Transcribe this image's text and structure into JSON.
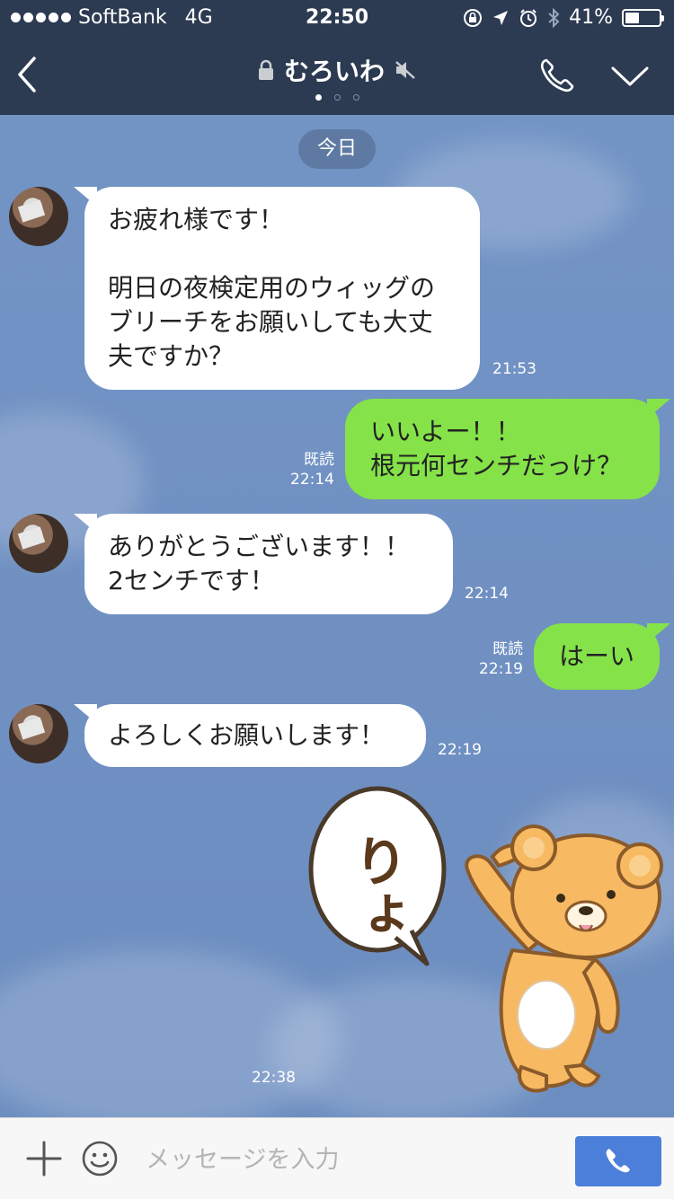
{
  "status": {
    "carrier": "SoftBank",
    "network": "4G",
    "time": "22:50",
    "battery": "41%",
    "battery_level": 0.41
  },
  "nav": {
    "title": "むろいわ",
    "page_count": 3,
    "active_page": 1
  },
  "chat": {
    "date_label": "今日",
    "messages": [
      {
        "side": "in",
        "lines": [
          "お疲れ様です！",
          "",
          "明日の夜検定用のウィッグの",
          "ブリーチをお願いしても大丈",
          "夫ですか？"
        ],
        "time": "21:53"
      },
      {
        "side": "out",
        "lines": [
          "いいよー！！",
          "根元何センチだっけ？"
        ],
        "read": "既読",
        "time": "22:14"
      },
      {
        "side": "in",
        "lines": [
          "ありがとうございます！！",
          "2センチです！"
        ],
        "time": "22:14"
      },
      {
        "side": "out",
        "lines": [
          "はーい"
        ],
        "read": "既読",
        "time": "22:19"
      },
      {
        "side": "in",
        "lines": [
          "よろしくお願いします！"
        ],
        "time": "22:19"
      }
    ],
    "sticker": {
      "text": "りょ",
      "time": "22:38"
    }
  },
  "input": {
    "placeholder": "メッセージを入力"
  },
  "colors": {
    "header_bg": "#2c3b52",
    "chat_bg": "#7092c4",
    "incoming_bubble": "#ffffff",
    "outgoing_bubble": "#85e249",
    "send_button": "#4c7fd9"
  }
}
